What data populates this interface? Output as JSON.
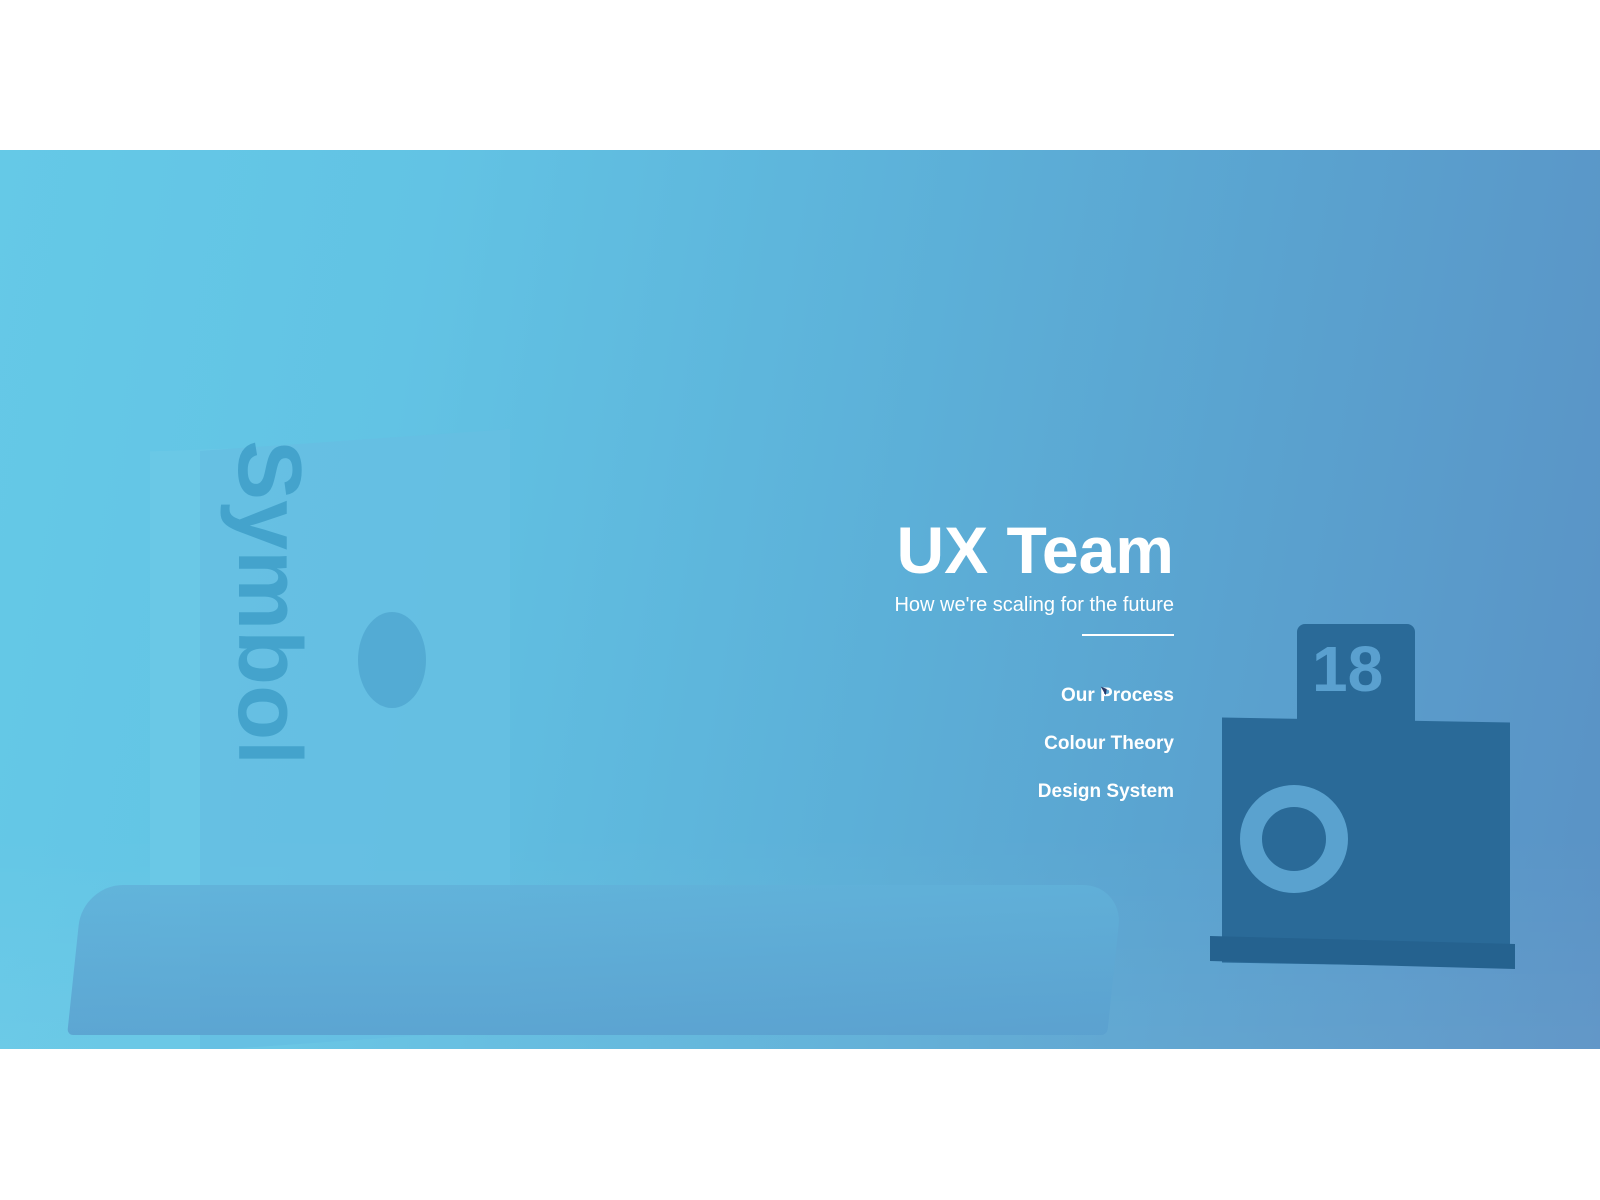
{
  "hero": {
    "title": "UX Team",
    "subtitle": "How we're scaling for the future",
    "links": [
      {
        "label": "Our Process"
      },
      {
        "label": "Colour Theory"
      },
      {
        "label": "Design System"
      }
    ],
    "background_image": {
      "book_title": "Symbol",
      "sign_number": "18"
    }
  },
  "colors": {
    "gradient_start": "#65c9e7",
    "gradient_end": "#5a92c5",
    "text": "#ffffff"
  }
}
